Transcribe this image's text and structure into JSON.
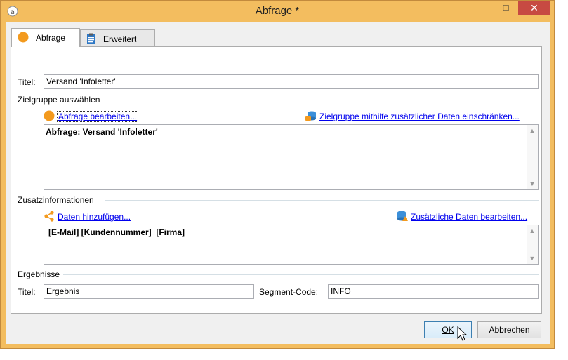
{
  "window": {
    "title": "Abfrage *",
    "controls": {
      "minimize": "–",
      "maximize": "□",
      "close": "✕"
    }
  },
  "tabs": [
    {
      "label": "Abfrage",
      "icon": "orange-circle-icon",
      "active": true
    },
    {
      "label": "Erweitert",
      "icon": "clipboard-icon",
      "active": false
    }
  ],
  "title_field": {
    "label": "Titel:",
    "value": "Versand 'Infoletter'"
  },
  "target": {
    "section_label": "Zielgruppe auswählen",
    "edit_link": "Abfrage bearbeiten...",
    "restrict_link": "Zielgruppe mithilfe zusätzlicher Daten einschränken...",
    "query_text": "Abfrage: Versand 'Infoletter'"
  },
  "extra": {
    "section_label": "Zusatzinformationen",
    "add_link": "Daten hinzufügen...",
    "edit_link": "Zusätzliche Daten bearbeiten...",
    "fields_text": "[E-Mail] [Kundennummer]  [Firma]"
  },
  "results": {
    "section_label": "Ergebnisse",
    "title_label": "Titel:",
    "title_value": "Ergebnis",
    "segment_label": "Segment-Code:",
    "segment_value": "INFO"
  },
  "buttons": {
    "ok": "OK",
    "cancel": "Abbrechen"
  },
  "colors": {
    "frame": "#f3bd5f",
    "close": "#c74a42",
    "link": "#0000ee",
    "accent_orange": "#f39a1e"
  }
}
